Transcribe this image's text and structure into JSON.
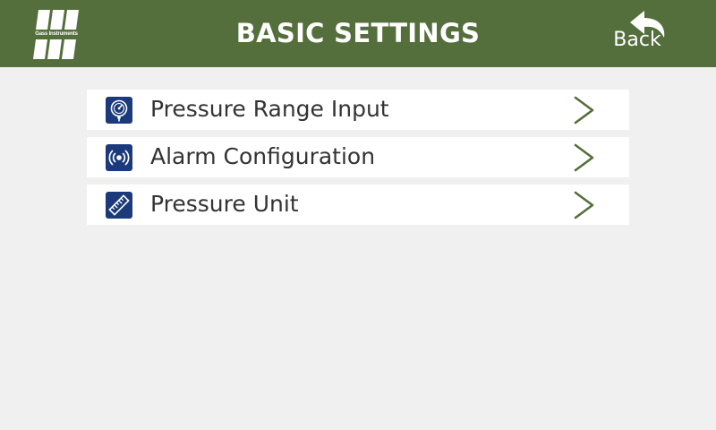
{
  "header": {
    "title": "BASIC SETTINGS",
    "logo": {
      "text": "Gass Instruments",
      "icon": "company-logo-icon"
    },
    "back": {
      "label": "Back",
      "icon": "back-arrow-icon"
    }
  },
  "menu": {
    "items": [
      {
        "label": "Pressure Range Input",
        "icon": "pressure-gauge-icon"
      },
      {
        "label": "Alarm Configuration",
        "icon": "alarm-broadcast-icon"
      },
      {
        "label": "Pressure Unit",
        "icon": "ruler-icon"
      }
    ],
    "chevron_icon": "chevron-right-icon"
  },
  "colors": {
    "header_bg": "#546e3c",
    "page_bg": "#f0f0f0",
    "item_bg": "#ffffff",
    "icon_bg": "#1b3a7c",
    "chevron": "#546e3c",
    "text": "#333333",
    "header_text": "#ffffff"
  }
}
